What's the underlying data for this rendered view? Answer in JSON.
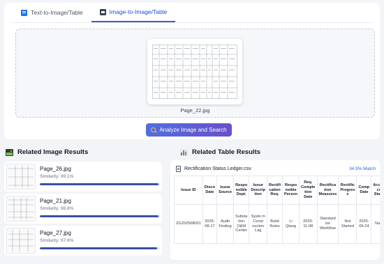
{
  "tabs": [
    {
      "label": "Text-to-Image/Table",
      "icon": "text-table-icon",
      "active": false
    },
    {
      "label": "Image-to-Image/Table",
      "icon": "image-icon",
      "active": true
    }
  ],
  "upload": {
    "preview_filename": "Page_22.jpg",
    "analyze_label": "Analyze Image and Search"
  },
  "related_images": {
    "title": "Related Image Results",
    "items": [
      {
        "name": "Page_26.jpg",
        "similarity_label": "Similarity: 99.1%",
        "similarity": 0.991
      },
      {
        "name": "Page_21.jpg",
        "similarity_label": "Similarity: 98.8%",
        "similarity": 0.988
      },
      {
        "name": "Page_27.jpg",
        "similarity_label": "Similarity: 97.6%",
        "similarity": 0.976
      }
    ]
  },
  "related_tables": {
    "title": "Related Table Results",
    "file_name": "Rectification Status Ledger.csv",
    "match_label": "34.9% Match",
    "columns": [
      "Issue ID",
      "Disco Date",
      "Issue Source",
      "Respo nsible Dept.",
      "Issue Descrip tion",
      "Rectifi cation Req.",
      "Respo nsible Person",
      "Req. Comple tion Date",
      "Rectifica tion Measures",
      "Rectific Progres s",
      "Comp Date",
      "Accep ce Statu"
    ],
    "rows": [
      [
        "ZG202508001",
        "2025- 08-17",
        "Audit Finding",
        "Substa tion O&M Center",
        "Syste m Const ruction Lag",
        "Build Rules",
        "Li Qiang",
        "2025- 11-08",
        "Standard ize Workflow",
        "Not Started",
        "2025- 09-24",
        "NaN"
      ]
    ]
  },
  "colors": {
    "accent": "#3b5bdb",
    "button_gradient_start": "#4f6fe0",
    "button_gradient_end": "#6a4fc9",
    "progress": "#3a4fa8",
    "match": "#2563eb"
  }
}
